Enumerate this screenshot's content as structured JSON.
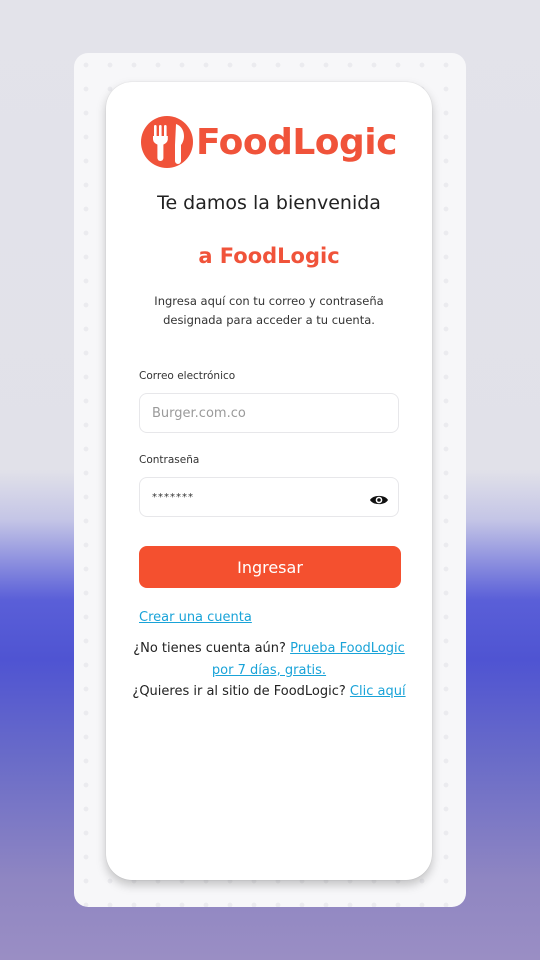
{
  "brand": {
    "name": "FoodLogic",
    "logo_icon": "fork-knife-icon",
    "accent_color": "#f0533a",
    "button_color": "#f4502f",
    "link_color": "#19a3d8"
  },
  "header": {
    "welcome": "Te damos la bienvenida",
    "brand_line": "a FoodLogic",
    "intro": "Ingresa aquí con tu correo y contraseña designada para acceder a tu cuenta."
  },
  "form": {
    "email_label": "Correo electrónico",
    "email_placeholder": "Burger.com.co",
    "password_label": "Contraseña",
    "password_value": "*******",
    "password_toggle_icon": "eye-icon",
    "submit_label": "Ingresar"
  },
  "links": {
    "create_account": "Crear una cuenta",
    "no_account_text": "¿No tienes cuenta aún?",
    "trial_link": "Prueba FoodLogic por 7 días, gratis.",
    "site_text": "¿Quieres ir al sitio de FoodLogic?",
    "site_link": "Clic aquí"
  }
}
